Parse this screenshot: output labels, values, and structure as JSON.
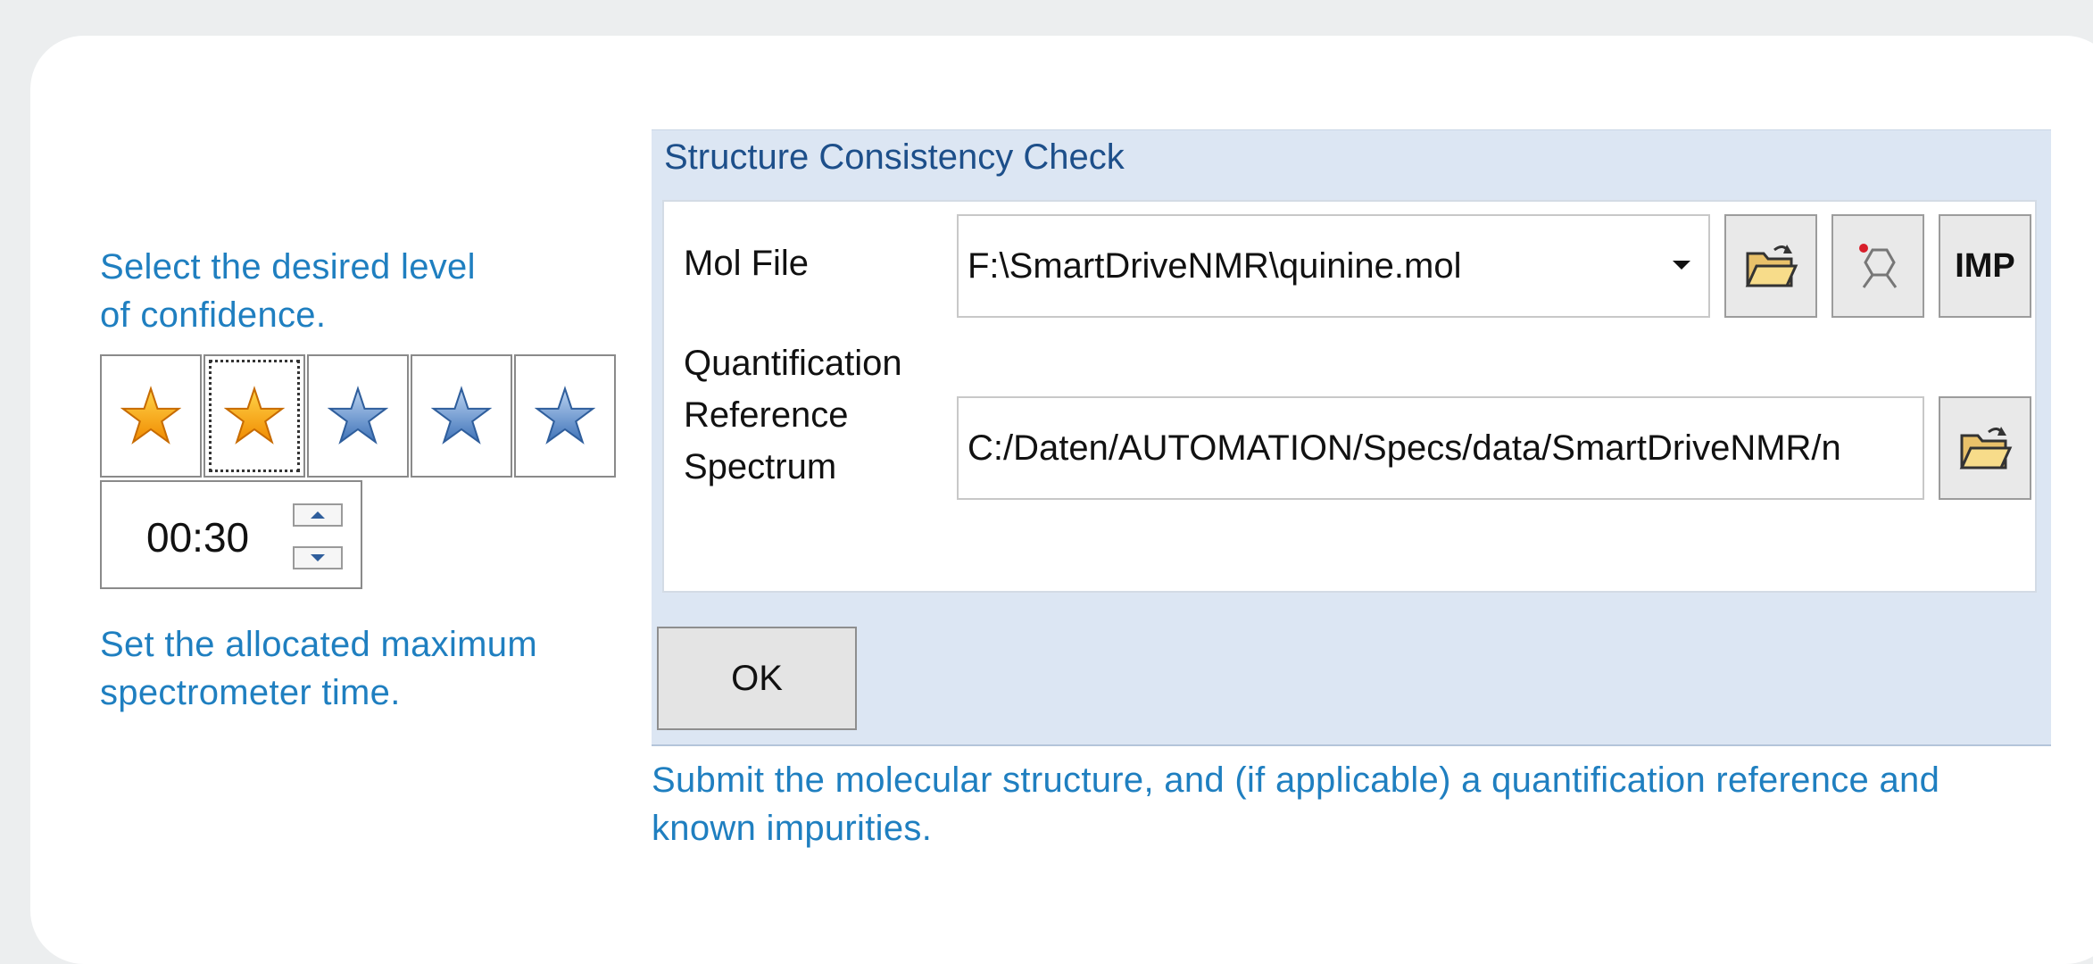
{
  "captions": {
    "confidence": "Select the desired level\nof confidence.",
    "time": "Set the allocated maximum\nspectrometer time.",
    "submit": "Submit the molecular structure, and (if applicable) a quantification reference and\nknown impurities."
  },
  "confidence": {
    "stars": [
      {
        "state": "selected",
        "color": "#f5a000"
      },
      {
        "state": "selected",
        "color": "#f5a000"
      },
      {
        "state": "unselected",
        "color": "#5b8ed0"
      },
      {
        "state": "unselected",
        "color": "#5b8ed0"
      },
      {
        "state": "unselected",
        "color": "#5b8ed0"
      }
    ],
    "focused_index": 1
  },
  "time_spinner": {
    "value": "00:30",
    "up_icon": "triangle-up-icon",
    "down_icon": "triangle-down-icon"
  },
  "dialog": {
    "title": "Structure Consistency Check",
    "mol_file": {
      "label": "Mol File",
      "value": "F:\\SmartDriveNMR\\quinine.mol",
      "open_icon": "folder-open-icon",
      "draw_icon": "molecule-editor-icon",
      "imp_label": "IMP"
    },
    "reference": {
      "label": "Quantification\nReference\nSpectrum",
      "value": "C:/Daten/AUTOMATION/Specs/data/SmartDriveNMR/n",
      "open_icon": "folder-open-icon"
    },
    "ok_label": "OK"
  },
  "colors": {
    "caption": "#1f7fc0",
    "dialog_bg": "#dce6f3",
    "title": "#1d4f8a",
    "star_gold": "#f5a000",
    "star_blue": "#5b8ed0"
  }
}
